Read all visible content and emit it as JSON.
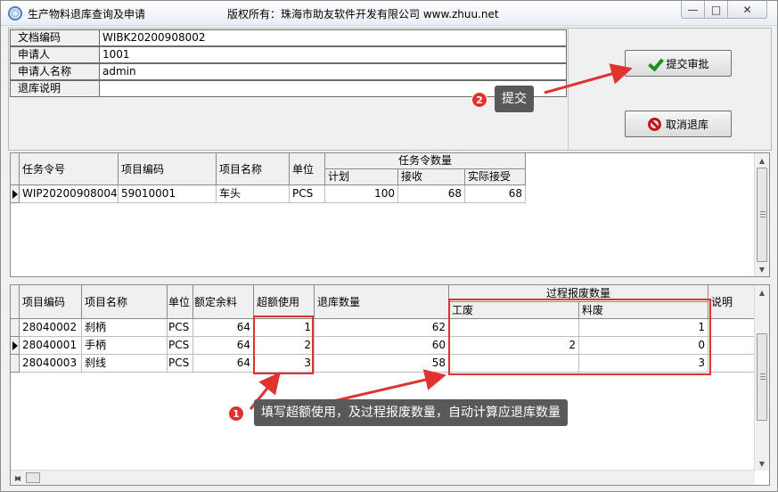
{
  "window": {
    "title": "生产物料退库查询及申请",
    "copyright": "版权所有：珠海市助友软件开发有限公司 www.zhuu.net",
    "min_glyph": "—",
    "max_glyph": "□",
    "close_glyph": "✕"
  },
  "form": {
    "rows": [
      {
        "label": "文档编码",
        "value": "WIBK20200908002"
      },
      {
        "label": "申请人",
        "value": "1001"
      },
      {
        "label": "申请人名称",
        "value": "admin"
      },
      {
        "label": "退库说明",
        "value": ""
      }
    ]
  },
  "buttons": {
    "submit": "提交审批",
    "cancel": "取消退库"
  },
  "task_grid": {
    "headers": {
      "task_no": "任务令号",
      "item_code": "项目编码",
      "item_name": "项目名称",
      "unit": "单位",
      "qty_group": "任务令数量",
      "plan": "计划",
      "received": "接收",
      "accepted": "实际接受"
    },
    "rows": [
      {
        "task_no": "WIP20200908004",
        "item_code": "59010001",
        "item_name": "车头",
        "unit": "PCS",
        "plan": "100",
        "received": "68",
        "accepted": "68"
      }
    ]
  },
  "material_grid": {
    "headers": {
      "item_code": "项目编码",
      "item_name": "项目名称",
      "unit": "单位",
      "quota_remain": "额定余料",
      "overuse": "超额使用",
      "return_qty": "退库数量",
      "scrap_group": "过程报废数量",
      "work_scrap": "工废",
      "material_scrap": "料废",
      "note": "说明"
    },
    "rows": [
      {
        "item_code": "28040002",
        "item_name": "刹柄",
        "unit": "PCS",
        "quota_remain": "64",
        "overuse": "1",
        "return_qty": "62",
        "work_scrap": "",
        "material_scrap": "1"
      },
      {
        "item_code": "28040001",
        "item_name": "手柄",
        "unit": "PCS",
        "quota_remain": "64",
        "overuse": "2",
        "return_qty": "60",
        "work_scrap": "2",
        "material_scrap": "0"
      },
      {
        "item_code": "28040003",
        "item_name": "刹线",
        "unit": "PCS",
        "quota_remain": "64",
        "overuse": "3",
        "return_qty": "58",
        "work_scrap": "",
        "material_scrap": "3"
      }
    ]
  },
  "annotations": {
    "step1_number": "1",
    "step1_text": "填写超额使用，及过程报废数量，自动计算应退库数量",
    "step2_number": "2",
    "step2_text": "提交",
    "highlight_color": "#e0322f"
  }
}
